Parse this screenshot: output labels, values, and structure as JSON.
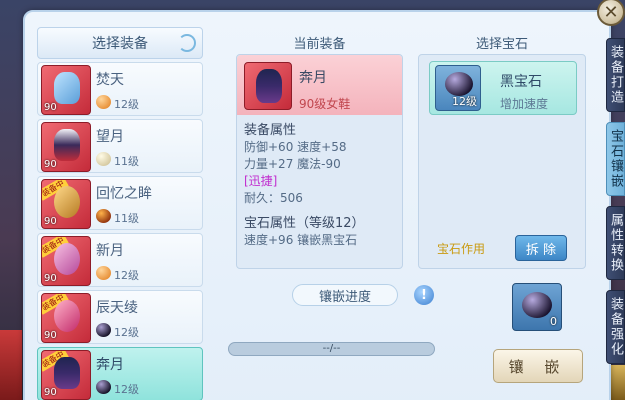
{
  "window": {
    "close_glyph": "✕"
  },
  "side_tabs": [
    {
      "label": "装备打造",
      "active": false
    },
    {
      "label": "宝石镶嵌",
      "active": true
    },
    {
      "label": "属性转换",
      "active": false
    },
    {
      "label": "装备强化",
      "active": false
    }
  ],
  "equipment_list": {
    "header": "选择装备",
    "items": [
      {
        "name": "焚天",
        "level": "90",
        "gem_level": "12级",
        "gem_color": "orange",
        "selected": false,
        "ribbon": ""
      },
      {
        "name": "望月",
        "level": "90",
        "gem_level": "11级",
        "gem_color": "pearl",
        "selected": false,
        "ribbon": ""
      },
      {
        "name": "回忆之眸",
        "level": "90",
        "gem_level": "11级",
        "gem_color": "multi",
        "selected": false,
        "ribbon": "装备中"
      },
      {
        "name": "新月",
        "level": "90",
        "gem_level": "12级",
        "gem_color": "orange",
        "selected": false,
        "ribbon": "装备中"
      },
      {
        "name": "辰天绫",
        "level": "90",
        "gem_level": "12级",
        "gem_color": "black",
        "selected": false,
        "ribbon": "装备中"
      },
      {
        "name": "奔月",
        "level": "90",
        "gem_level": "12级",
        "gem_color": "black",
        "selected": true,
        "ribbon": "装备中"
      }
    ]
  },
  "current_equipment": {
    "title": "当前装备",
    "name": "奔月",
    "subtitle": "90级女鞋",
    "attr_header": "装备属性",
    "attr_line1": "防御+60 速度+58",
    "attr_line2": "力量+27 魔法-90",
    "special": "[迅捷]",
    "durability": "耐久：506",
    "gem_attr_header": "宝石属性（等级12）",
    "gem_attr_line": "速度+96 镶嵌黑宝石"
  },
  "gem_select": {
    "title": "选择宝石",
    "gem_name": "黑宝石",
    "gem_desc": "增加速度",
    "gem_level": "12级",
    "effect_label": "宝石作用",
    "remove_label": "拆 除"
  },
  "inlay": {
    "progress_label": "镶嵌进度",
    "info_glyph": "!",
    "progress_text": "--/--",
    "progress_fraction": 0.0,
    "gem_count": "0",
    "inlay_button": "镶  嵌"
  }
}
